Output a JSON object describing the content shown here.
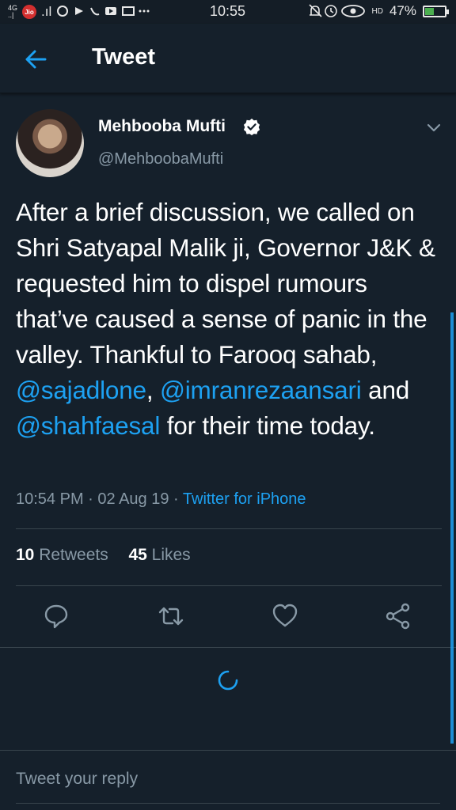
{
  "status_bar": {
    "network_top": "4G",
    "network_bottom": "..|",
    "jio": "Jio",
    "signal": ".ıl",
    "time": "10:55",
    "hd": "HD",
    "battery_percent": "47%",
    "battery_level": 0.47,
    "battery_color": "#4caf50"
  },
  "header": {
    "title": "Tweet"
  },
  "tweet": {
    "author_name": "Mehbooba Mufti",
    "handle": "@MehboobaMufti",
    "text_plain_1": "After a brief discussion, we called on Shri Satyapal Malik ji, Governor J&K & requested him to dispel rumours that’ve caused a sense of panic in the valley. Thankful to Farooq sahab, ",
    "mention_1": "@sajadlone",
    "text_plain_2": ",",
    "mention_2": "@imranrezaansari",
    "text_plain_3": " and",
    "mention_3": "@shahfaesal",
    "text_plain_4": " for their time today.",
    "time": "10:54 PM",
    "date": "02 Aug 19",
    "source": "Twitter for iPhone",
    "retweets_count": "10",
    "retweets_label": "Retweets",
    "likes_count": "45",
    "likes_label": "Likes"
  },
  "actions": {
    "reply_icon": "reply-icon",
    "retweet_icon": "retweet-icon",
    "like_icon": "heart-icon",
    "share_icon": "share-icon"
  },
  "reply": {
    "placeholder": "Tweet your reply"
  },
  "colors": {
    "background": "#15202b",
    "accent": "#1da1f2",
    "secondary_text": "#8899a6",
    "divider": "#38444d"
  }
}
